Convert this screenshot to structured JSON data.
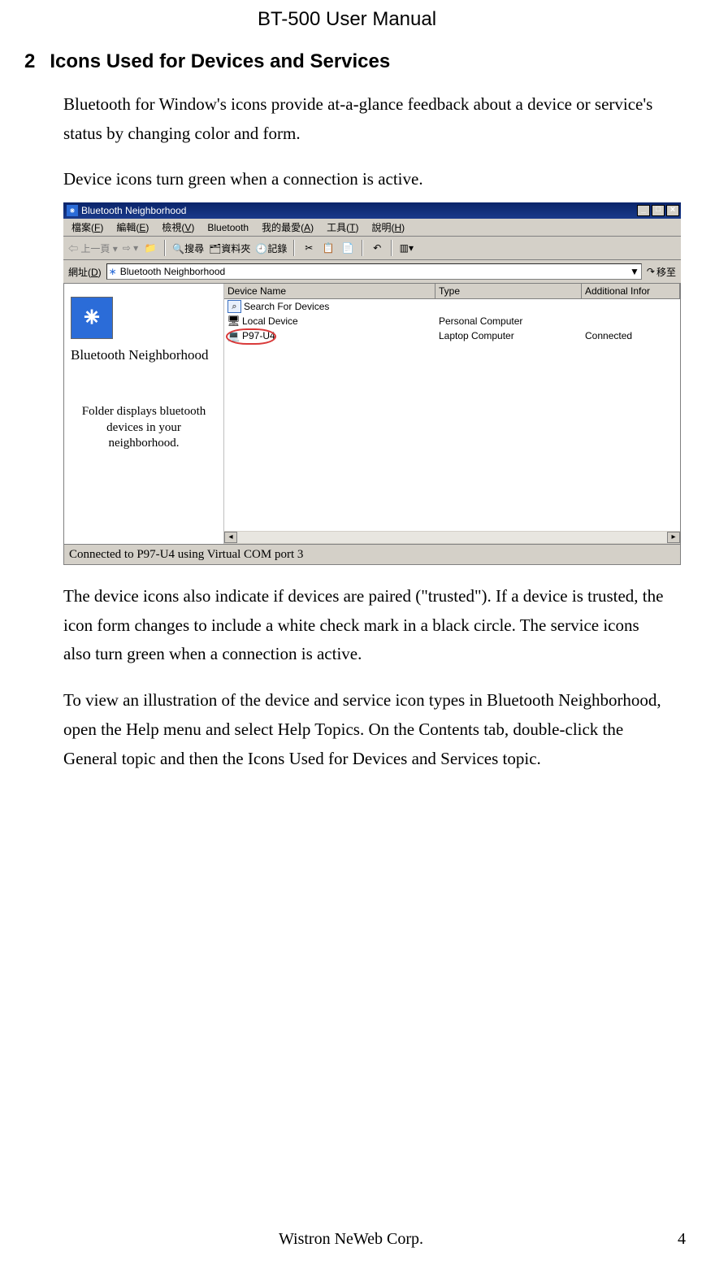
{
  "doc": {
    "title": "BT-500 User Manual",
    "section_num": "2",
    "section_heading": "Icons Used for Devices and Services",
    "para1": "Bluetooth for Window's icons provide at-a-glance feedback about a device or service's status by changing color and form.",
    "para2": "Device icons turn green when a connection is active.",
    "para3": "The device icons also indicate if devices are paired (\"trusted\"). If a device is trusted, the icon form changes to include a white check mark in a black circle. The service icons also turn green when a connection is active.",
    "para4": "To view an illustration of the device and service icon types in Bluetooth Neighborhood, open the Help menu and select Help Topics. On the Contents tab, double-click the General topic and then the Icons Used for Devices and Services topic.",
    "footer_company": "Wistron NeWeb Corp.",
    "page_number": "4"
  },
  "window": {
    "title": "Bluetooth Neighborhood",
    "menu": {
      "file_pre": "檔案(",
      "file_u": "F",
      "file_post": ")",
      "edit_pre": "編輯(",
      "edit_u": "E",
      "edit_post": ")",
      "view_pre": "檢視(",
      "view_u": "V",
      "view_post": ")",
      "bt": "Bluetooth",
      "fav_pre": "我的最愛(",
      "fav_u": "A",
      "fav_post": ")",
      "tools_pre": "工具(",
      "tools_u": "T",
      "tools_post": ")",
      "help_pre": "說明(",
      "help_u": "H",
      "help_post": ")"
    },
    "toolbar": {
      "back": "上一頁",
      "search": "搜尋",
      "folders": "資料夾",
      "history": "記錄"
    },
    "address": {
      "label_pre": "網址(",
      "label_u": "D",
      "label_post": ")",
      "value": "Bluetooth Neighborhood",
      "go": "移至"
    },
    "side": {
      "title": "Bluetooth Neighborhood",
      "desc": "Folder displays bluetooth devices in your neighborhood."
    },
    "columns": {
      "name": "Device Name",
      "type": "Type",
      "addl": "Additional Infor"
    },
    "rows": [
      {
        "name": "Search For Devices",
        "type": "",
        "addl": ""
      },
      {
        "name": "Local Device",
        "type": "Personal Computer",
        "addl": ""
      },
      {
        "name": "P97-U4",
        "type": "Laptop Computer",
        "addl": "Connected"
      }
    ],
    "status": "Connected to P97-U4 using Virtual COM port 3"
  }
}
